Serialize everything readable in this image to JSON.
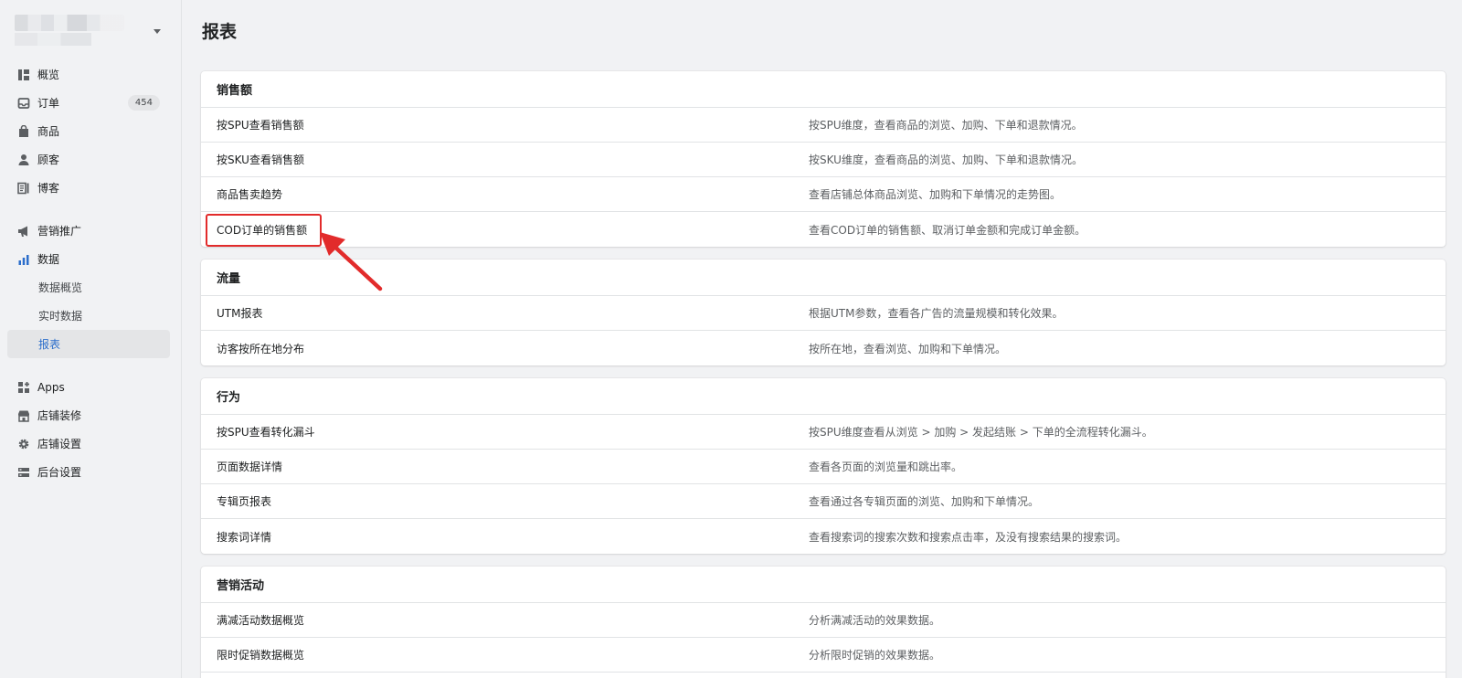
{
  "sidebar": {
    "items": [
      {
        "label": "概览",
        "icon": "overview-icon"
      },
      {
        "label": "订单",
        "icon": "orders-icon",
        "badge": "454"
      },
      {
        "label": "商品",
        "icon": "products-icon"
      },
      {
        "label": "顾客",
        "icon": "customers-icon"
      },
      {
        "label": "博客",
        "icon": "blog-icon"
      },
      {
        "label": "营销推广",
        "icon": "marketing-icon"
      },
      {
        "label": "数据",
        "icon": "analytics-icon",
        "icon_color": "#2c6ecb"
      },
      {
        "label": "Apps",
        "icon": "apps-icon"
      },
      {
        "label": "店铺装修",
        "icon": "store-design-icon"
      },
      {
        "label": "店铺设置",
        "icon": "settings-icon"
      },
      {
        "label": "后台设置",
        "icon": "admin-settings-icon"
      }
    ],
    "sub_items": [
      {
        "label": "数据概览"
      },
      {
        "label": "实时数据"
      },
      {
        "label": "报表",
        "active": true
      }
    ]
  },
  "page": {
    "title": "报表"
  },
  "sections": [
    {
      "title": "销售额",
      "rows": [
        {
          "name": "按SPU查看销售额",
          "desc": "按SPU维度，查看商品的浏览、加购、下单和退款情况。"
        },
        {
          "name": "按SKU查看销售额",
          "desc": "按SKU维度，查看商品的浏览、加购、下单和退款情况。"
        },
        {
          "name": "商品售卖趋势",
          "desc": "查看店铺总体商品浏览、加购和下单情况的走势图。"
        },
        {
          "name": "COD订单的销售额",
          "desc": "查看COD订单的销售额、取消订单金额和完成订单金额。"
        }
      ]
    },
    {
      "title": "流量",
      "rows": [
        {
          "name": "UTM报表",
          "desc": "根据UTM参数，查看各广告的流量规模和转化效果。"
        },
        {
          "name": "访客按所在地分布",
          "desc": "按所在地，查看浏览、加购和下单情况。"
        }
      ]
    },
    {
      "title": "行为",
      "rows": [
        {
          "name": "按SPU查看转化漏斗",
          "desc": "按SPU维度查看从浏览 > 加购 > 发起结账 > 下单的全流程转化漏斗。"
        },
        {
          "name": "页面数据详情",
          "desc": "查看各页面的浏览量和跳出率。"
        },
        {
          "name": "专辑页报表",
          "desc": "查看通过各专辑页面的浏览、加购和下单情况。"
        },
        {
          "name": "搜索词详情",
          "desc": "查看搜索词的搜索次数和搜索点击率，及没有搜索结果的搜索词。"
        }
      ]
    },
    {
      "title": "营销活动",
      "rows": [
        {
          "name": "满减活动数据概览",
          "desc": "分析满减活动的效果数据。"
        },
        {
          "name": "限时促销数据概览",
          "desc": "分析限时促销的效果数据。"
        }
      ]
    }
  ],
  "colors": {
    "accent": "#2c6ecb",
    "annotation": "#e22b2b"
  }
}
